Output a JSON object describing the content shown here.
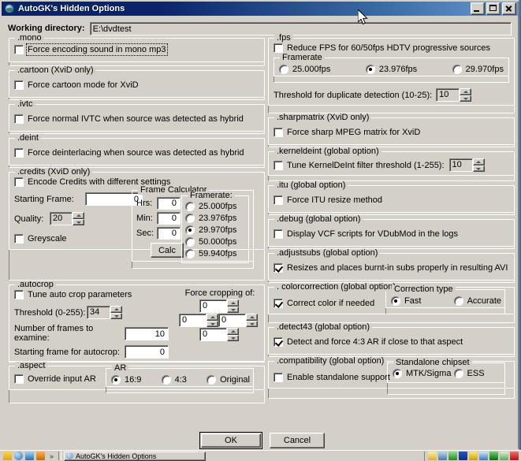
{
  "window": {
    "title": "AutoGK's Hidden Options",
    "icon": "autogk-globe-icon",
    "buttons": {
      "minimize": "_",
      "maximize": "□",
      "close": "×"
    }
  },
  "working_directory": {
    "label": "Working directory:",
    "value": "E:\\dvdtest"
  },
  "left_column": {
    "mono": {
      "legend": ".mono",
      "checkbox": {
        "label": "Force encoding sound in mono mp3",
        "checked": false,
        "focused": true
      }
    },
    "cartoon": {
      "legend": ".cartoon (XviD only)",
      "checkbox": {
        "label": "Force cartoon mode for XviD",
        "checked": false
      }
    },
    "ivtc": {
      "legend": ".ivtc",
      "checkbox": {
        "label": "Force normal IVTC when source was detected as hybrid",
        "checked": false
      }
    },
    "deint": {
      "legend": ".deint",
      "checkbox": {
        "label": "Force deinterlacing when source was detected as hybrid",
        "checked": false
      }
    },
    "credits": {
      "legend": ".credits (XviD only)",
      "checkbox": {
        "label": "Encode Credits with different settings",
        "checked": false
      },
      "starting_frame": {
        "label": "Starting Frame:",
        "value": "0"
      },
      "quality": {
        "label": "Quality:",
        "value": "20"
      },
      "greyscale": {
        "label": "Greyscale",
        "checked": false
      },
      "frame_calculator": {
        "legend": "Frame Calculator",
        "hrs": {
          "label": "Hrs:",
          "value": "0"
        },
        "min": {
          "label": "Min:",
          "value": "0"
        },
        "sec": {
          "label": "Sec:",
          "value": "0"
        },
        "calc_button": "Calc",
        "framerate": {
          "legend": "Framerate:",
          "options": [
            "25.000fps",
            "23.976fps",
            "29.970fps",
            "50.000fps",
            "59.940fps"
          ],
          "selected": "29.970fps"
        }
      }
    },
    "autocrop": {
      "legend": ".autocrop",
      "checkbox": {
        "label": "Tune auto crop parameters",
        "checked": false
      },
      "threshold": {
        "label": "Threshold (0-255):",
        "value": "34"
      },
      "frames_to_examine": {
        "label": "Number of frames to examine:",
        "value": "10"
      },
      "starting_frame": {
        "label": "Starting frame for autocrop:",
        "value": "0"
      },
      "force_cropping": {
        "label": "Force cropping of:",
        "top": "0",
        "left": "0",
        "right": "0",
        "bottom": "0"
      }
    },
    "aspect": {
      "legend": ".aspect",
      "checkbox": {
        "label": "Override input AR",
        "checked": false
      },
      "ar": {
        "legend": "AR",
        "options": [
          "16:9",
          "4:3",
          "Original"
        ],
        "selected": "16:9"
      }
    }
  },
  "right_column": {
    "fps": {
      "legend": ".fps",
      "checkbox": {
        "label": "Reduce FPS for 60/50fps HDTV progressive sources",
        "checked": false
      },
      "framerate": {
        "legend": "Framerate",
        "options": [
          "25.000fps",
          "23.976fps",
          "29.970fps"
        ],
        "selected": "23.976fps"
      },
      "threshold": {
        "label": "Threshold for duplicate detection (10-25):",
        "value": "10"
      }
    },
    "sharpmatrix": {
      "legend": ".sharpmatrix (XviD only)",
      "checkbox": {
        "label": "Force sharp MPEG matrix for XviD",
        "checked": false
      }
    },
    "kerneldeint": {
      "legend": ".kerneldeint (global option)",
      "checkbox": {
        "label": "Tune KernelDeInt filter threshold (1-255):",
        "checked": false
      },
      "value": "10"
    },
    "itu": {
      "legend": ".itu (global option)",
      "checkbox": {
        "label": "Force ITU resize method",
        "checked": false
      }
    },
    "debug": {
      "legend": ".debug (global option)",
      "checkbox": {
        "label": "Display VCF scripts for VDubMod in the logs",
        "checked": false
      }
    },
    "adjustsubs": {
      "legend": ".adjustsubs (global option)",
      "checkbox": {
        "label": "Resizes and places burnt-in subs properly in resulting AVI",
        "checked": true
      }
    },
    "colorcorrection": {
      "legend": ". colorcorrection (global option)",
      "checkbox": {
        "label": "Correct color if needed",
        "checked": true
      },
      "correction_type": {
        "legend": "Correction type",
        "options": [
          "Fast",
          "Accurate"
        ],
        "selected": "Fast"
      }
    },
    "detect43": {
      "legend": ".detect43 (global option)",
      "checkbox": {
        "label": "Detect and force 4:3 AR if close to that aspect",
        "checked": true
      }
    },
    "compatibility": {
      "legend": ".compatibility (global option)",
      "checkbox": {
        "label": "Enable standalone support",
        "checked": false
      },
      "standalone_chipset": {
        "legend": "Standalone chipset",
        "options": [
          "MTK/Sigma",
          "ESS"
        ],
        "selected": "MTK/Sigma"
      }
    }
  },
  "footer": {
    "ok": "OK",
    "cancel": "Cancel"
  },
  "taskbar": {
    "quicklaunch_overflow": "»",
    "task_button": "AutoGK's Hidden Options"
  },
  "colors": {
    "face": "#d4d0c8",
    "title_active_start": "#0a246a",
    "title_active_end": "#6a9ad0",
    "desktop": "#3a6ea5",
    "field": "#ffffff"
  }
}
